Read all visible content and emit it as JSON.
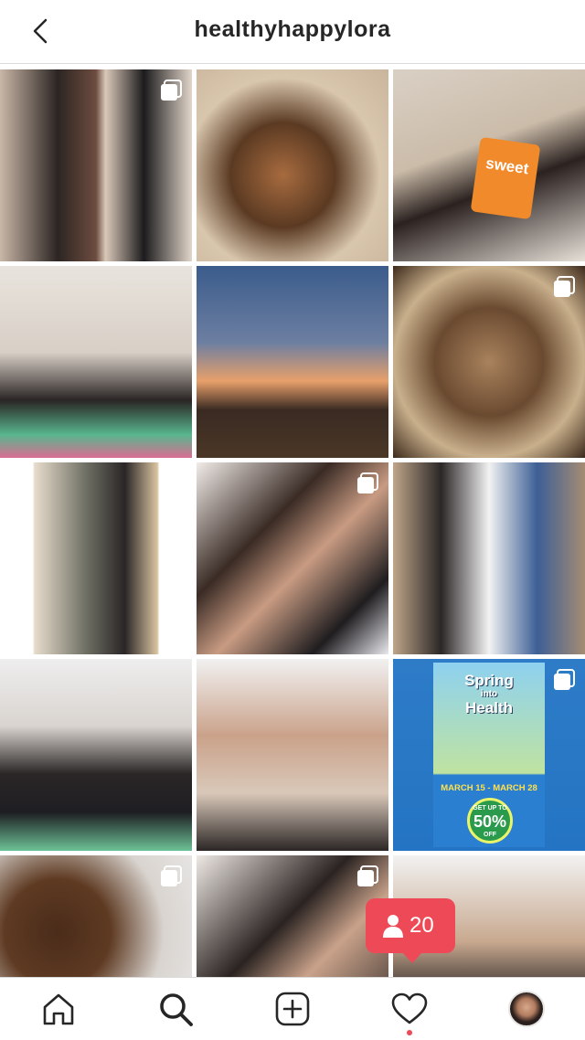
{
  "header": {
    "title": "healthyhappylora",
    "back_icon": "chevron-left-icon"
  },
  "posts": [
    {
      "id_label": "post-1",
      "multi": true
    },
    {
      "id_label": "post-2",
      "multi": false
    },
    {
      "id_label": "post-3",
      "multi": false,
      "text": "sweet"
    },
    {
      "id_label": "post-4",
      "multi": false
    },
    {
      "id_label": "post-5",
      "multi": false
    },
    {
      "id_label": "post-6",
      "multi": true
    },
    {
      "id_label": "post-7",
      "multi": false
    },
    {
      "id_label": "post-8",
      "multi": true
    },
    {
      "id_label": "post-9",
      "multi": false
    },
    {
      "id_label": "post-10",
      "multi": false
    },
    {
      "id_label": "post-11",
      "multi": false
    },
    {
      "id_label": "post-12",
      "multi": true
    },
    {
      "id_label": "post-13",
      "multi": true
    },
    {
      "id_label": "post-14",
      "multi": true
    },
    {
      "id_label": "post-15",
      "multi": false
    }
  ],
  "promo": {
    "title_line1": "Spring",
    "title_into": "into",
    "title_line2": "Health",
    "dates": "MARCH 15 - MARCH 28",
    "badge_top": "GET UP TO",
    "badge_value": "50%",
    "badge_bottom": "OFF"
  },
  "notification": {
    "icon": "person-icon",
    "count": "20",
    "color": "#ed4956"
  },
  "tabbar": {
    "items": [
      "home-icon",
      "search-icon",
      "new-post-icon",
      "activity-icon",
      "profile-avatar"
    ],
    "active": "search-icon"
  }
}
